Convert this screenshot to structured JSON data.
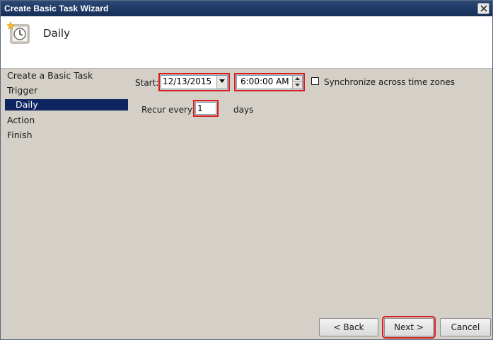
{
  "window": {
    "title": "Create Basic Task Wizard",
    "close_icon": "close-icon"
  },
  "header": {
    "title": "Daily",
    "icon": "task-scheduler-clock-icon"
  },
  "sidebar": {
    "items": [
      {
        "label": "Create a Basic Task",
        "active": false
      },
      {
        "label": "Trigger",
        "active": false
      },
      {
        "label": "Daily",
        "active": true
      },
      {
        "label": "Action",
        "active": false
      },
      {
        "label": "Finish",
        "active": false
      }
    ]
  },
  "form": {
    "start_label": "Start:",
    "start_date": "12/13/2015",
    "start_time": "6:00:00 AM",
    "sync_label": "Synchronize across time zones",
    "sync_checked": false,
    "recur_label": "Recur every:",
    "recur_value": "1",
    "recur_unit": "days"
  },
  "buttons": {
    "back": "< Back",
    "next": "Next >",
    "cancel": "Cancel"
  },
  "colors": {
    "titlebar": "#1f3a66",
    "selection": "#0e2561",
    "highlight_outline": "#d41f1f",
    "dialog_bg": "#d4d0c8"
  }
}
